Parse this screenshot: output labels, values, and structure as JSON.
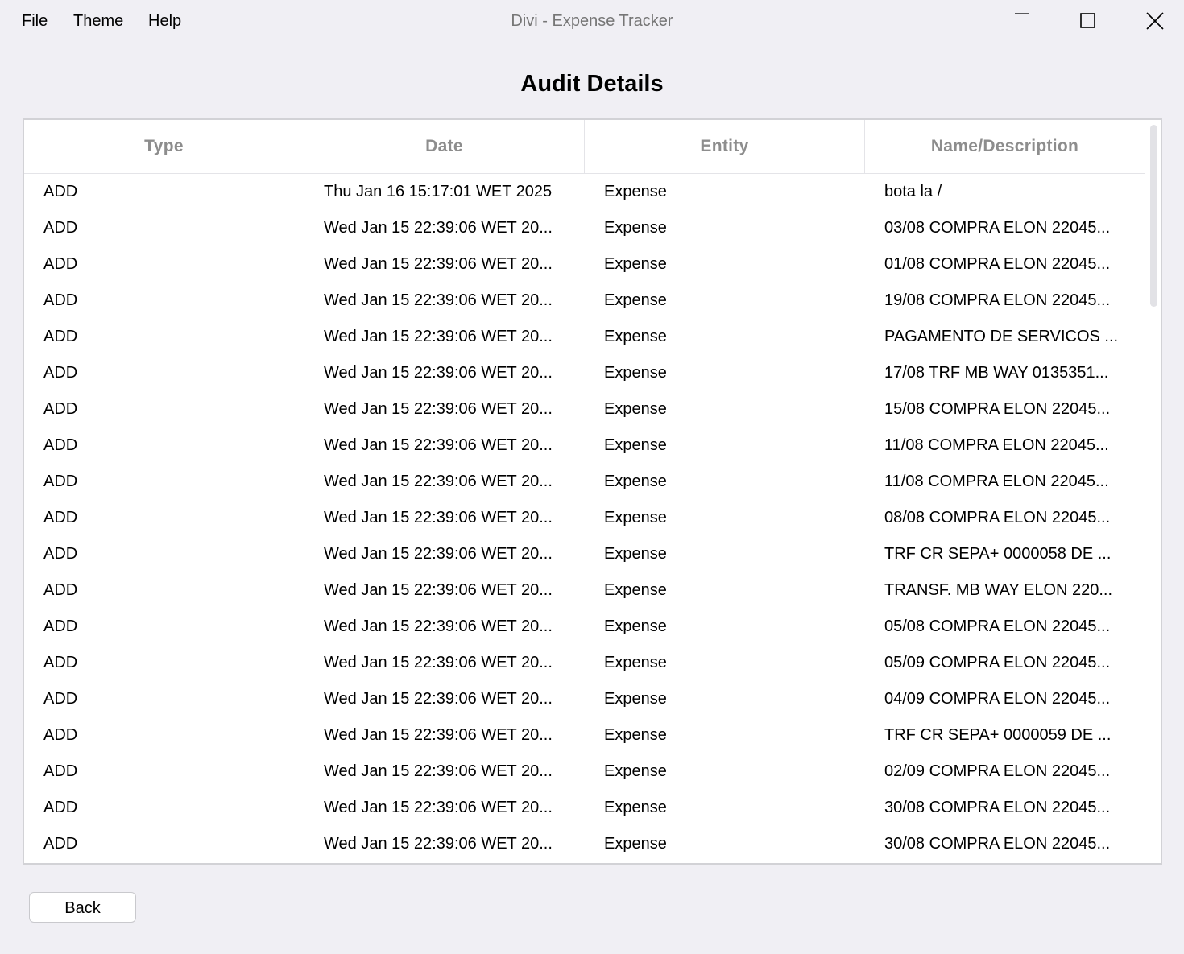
{
  "menu": {
    "file": "File",
    "theme": "Theme",
    "help": "Help"
  },
  "window": {
    "title": "Divi - Expense Tracker"
  },
  "page": {
    "title": "Audit Details"
  },
  "table": {
    "headers": [
      "Type",
      "Date",
      "Entity",
      "Name/Description"
    ],
    "rows": [
      [
        "ADD",
        "Thu Jan 16 15:17:01 WET 2025",
        "Expense",
        "bota la /"
      ],
      [
        "ADD",
        "Wed Jan 15 22:39:06 WET 20...",
        "Expense",
        "03/08 COMPRA ELON 22045..."
      ],
      [
        "ADD",
        "Wed Jan 15 22:39:06 WET 20...",
        "Expense",
        "01/08 COMPRA ELON 22045..."
      ],
      [
        "ADD",
        "Wed Jan 15 22:39:06 WET 20...",
        "Expense",
        "19/08 COMPRA ELON 22045..."
      ],
      [
        "ADD",
        "Wed Jan 15 22:39:06 WET 20...",
        "Expense",
        "PAGAMENTO DE SERVICOS ..."
      ],
      [
        "ADD",
        "Wed Jan 15 22:39:06 WET 20...",
        "Expense",
        "17/08 TRF MB WAY 0135351..."
      ],
      [
        "ADD",
        "Wed Jan 15 22:39:06 WET 20...",
        "Expense",
        "15/08 COMPRA ELON 22045..."
      ],
      [
        "ADD",
        "Wed Jan 15 22:39:06 WET 20...",
        "Expense",
        "11/08 COMPRA ELON 22045..."
      ],
      [
        "ADD",
        "Wed Jan 15 22:39:06 WET 20...",
        "Expense",
        "11/08 COMPRA ELON 22045..."
      ],
      [
        "ADD",
        "Wed Jan 15 22:39:06 WET 20...",
        "Expense",
        "08/08 COMPRA ELON 22045..."
      ],
      [
        "ADD",
        "Wed Jan 15 22:39:06 WET 20...",
        "Expense",
        "TRF CR SEPA+ 0000058 DE ..."
      ],
      [
        "ADD",
        "Wed Jan 15 22:39:06 WET 20...",
        "Expense",
        "TRANSF. MB WAY ELON 220..."
      ],
      [
        "ADD",
        "Wed Jan 15 22:39:06 WET 20...",
        "Expense",
        "05/08 COMPRA ELON 22045..."
      ],
      [
        "ADD",
        "Wed Jan 15 22:39:06 WET 20...",
        "Expense",
        "05/09 COMPRA ELON 22045..."
      ],
      [
        "ADD",
        "Wed Jan 15 22:39:06 WET 20...",
        "Expense",
        "04/09 COMPRA ELON 22045..."
      ],
      [
        "ADD",
        "Wed Jan 15 22:39:06 WET 20...",
        "Expense",
        "TRF CR SEPA+ 0000059 DE ..."
      ],
      [
        "ADD",
        "Wed Jan 15 22:39:06 WET 20...",
        "Expense",
        "02/09 COMPRA ELON 22045..."
      ],
      [
        "ADD",
        "Wed Jan 15 22:39:06 WET 20...",
        "Expense",
        "30/08 COMPRA ELON 22045..."
      ],
      [
        "ADD",
        "Wed Jan 15 22:39:06 WET 20...",
        "Expense",
        "30/08 COMPRA ELON 22045..."
      ]
    ]
  },
  "buttons": {
    "back": "Back"
  },
  "icons": {
    "minimize": "minimize-icon",
    "maximize": "maximize-icon",
    "close": "close-icon"
  },
  "colors": {
    "background": "#f0eff4",
    "header_text": "#8d8d8d",
    "window_title_text": "#767676"
  }
}
